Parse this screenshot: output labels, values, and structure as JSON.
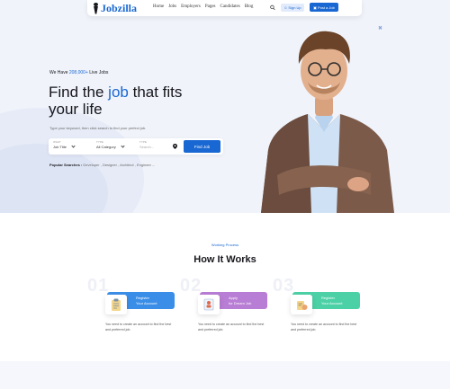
{
  "nav": {
    "logo": "Jobzilla",
    "links": [
      "Home",
      "Jobs",
      "Employers",
      "Pages",
      "Candidates",
      "Blog"
    ],
    "signup": "Sign Up",
    "post_job": "Post a Job"
  },
  "hero": {
    "live_prefix": "We Have",
    "live_count": "208,000+",
    "live_suffix": "Live Jobs",
    "headline_1": "Find the",
    "headline_hl": "job",
    "headline_2": "that fits",
    "headline_3": "your life",
    "subline": "Type your keyword, then click search to find your perfect job."
  },
  "search": {
    "what_label": "WHAT",
    "what_value": "Job Title",
    "type_label": "TYPE",
    "type_value": "All Category",
    "location_label": "TYPE",
    "location_placeholder": "Search...",
    "find_button": "Find Job"
  },
  "popular": {
    "label": "Popular Searches :",
    "terms": "Developer , Designer , Architect , Engineer ..."
  },
  "how_it_works": {
    "tag": "Working Process",
    "title": "How It Works",
    "steps": [
      {
        "num": "01",
        "line1": "Register",
        "line2": "Your Account",
        "desc": "You need to create an account to find the best and preferred job.",
        "color": "#3b8ee8",
        "icon": "clipboard-icon"
      },
      {
        "num": "02",
        "line1": "Apply",
        "line2": "for Dream Job",
        "desc": "You need to create an account to find the best and preferred job.",
        "color": "#b87dd4",
        "icon": "resume-icon"
      },
      {
        "num": "03",
        "line1": "Register",
        "line2": "Your Account",
        "desc": "You need to create an account to find the best and preferred job.",
        "color": "#4cd1a6",
        "icon": "contract-icon"
      }
    ]
  },
  "colors": {
    "primary": "#1967d2",
    "hero_bg": "#f0f3fa"
  }
}
